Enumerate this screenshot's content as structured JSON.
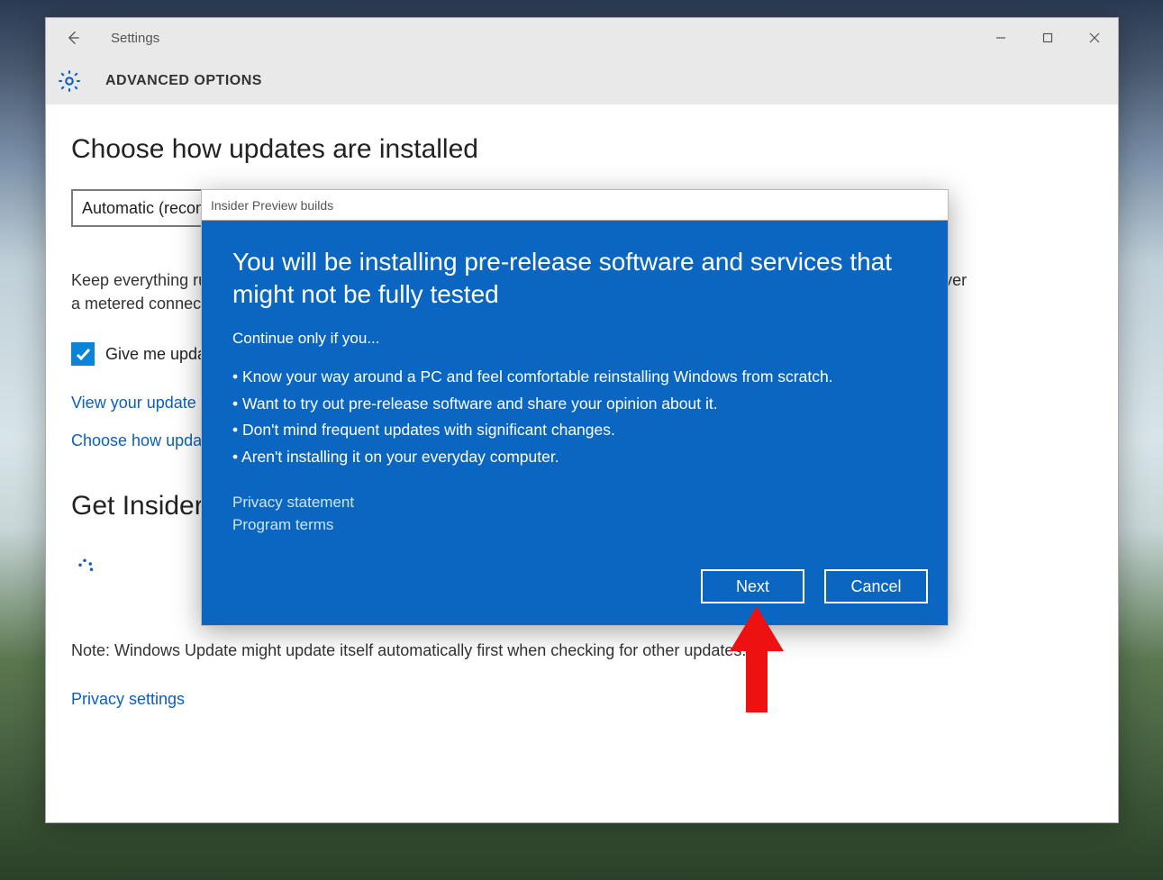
{
  "window": {
    "app_name": "Settings",
    "page_title": "ADVANCED OPTIONS"
  },
  "main": {
    "section1_heading": "Choose how updates are installed",
    "dropdown_value": "Automatic (recommended)",
    "body_text": "Keep everything running smoothly. We'll restart your PC automatically when you're not using it. Updates won't download over a metered connection (where charges may apply).",
    "checkbox_label": "Give me updates for other Microsoft products when I update Windows.",
    "link_history": "View your update history",
    "link_delivery": "Choose how updates are delivered",
    "section2_heading": "Get Insider builds",
    "note_text": "Note: Windows Update might update itself automatically first when checking for other updates.",
    "privacy_link": "Privacy settings"
  },
  "dialog": {
    "title": "Insider Preview builds",
    "heading": "You will be installing pre-release software and services that might not be fully tested",
    "intro": "Continue only if you...",
    "bullets": [
      "Know your way around a PC and feel comfortable reinstalling Windows from scratch.",
      "Want to try out pre-release software and share your opinion about it.",
      "Don't mind frequent updates with significant changes.",
      "Aren't installing it on your everyday computer."
    ],
    "privacy_link": "Privacy statement",
    "terms_link": "Program terms",
    "next_btn": "Next",
    "cancel_btn": "Cancel"
  }
}
